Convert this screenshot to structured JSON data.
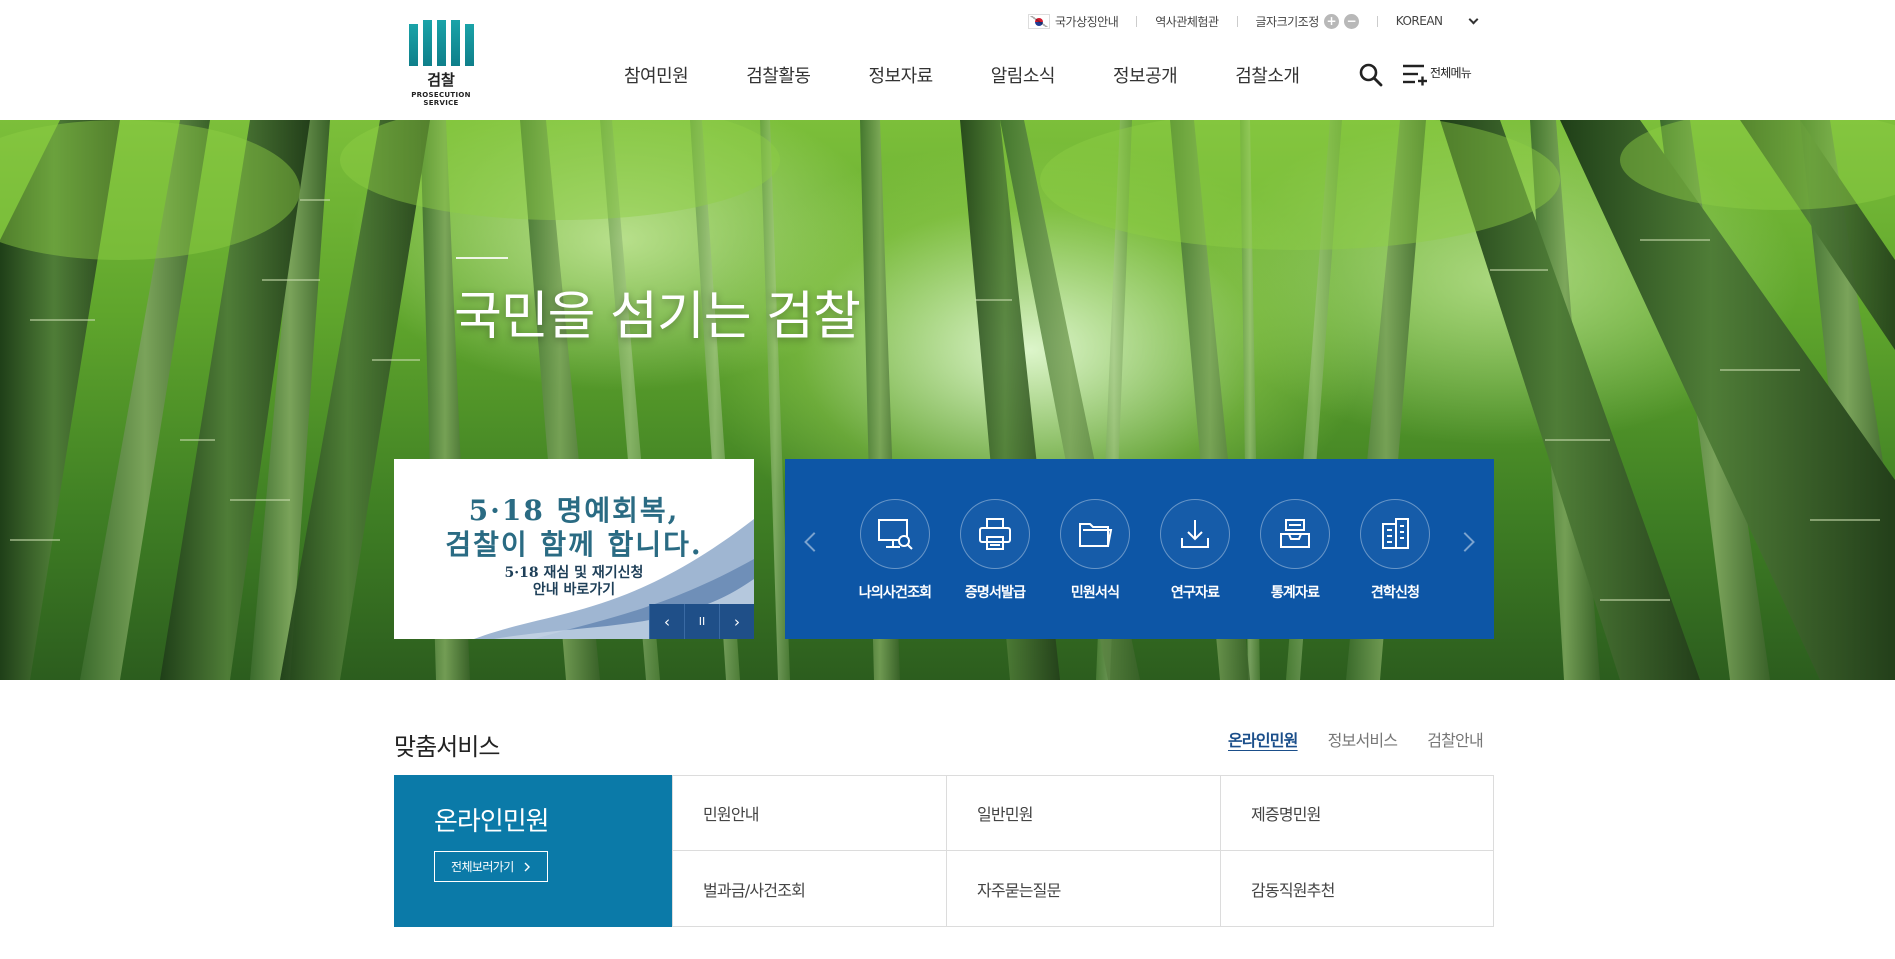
{
  "logo": {
    "ko": "검찰",
    "en": "PROSECUTION SERVICE"
  },
  "util": {
    "symbol": "국가상징안내",
    "history": "역사관체험관",
    "font_size": "글자크기조정",
    "font_plus": "+",
    "font_minus": "−",
    "language": "KOREAN"
  },
  "gnb": [
    "참여민원",
    "검찰활동",
    "정보자료",
    "알림소식",
    "정보공개",
    "검찰소개"
  ],
  "all_menu_label": "전체메뉴",
  "hero": {
    "headline": "국민을 섬기는 검찰"
  },
  "banner": {
    "line1": "5·18 명예회복,",
    "line2": "검찰이 함께 합니다.",
    "line3": "5·18 재심 및 재기신청",
    "line4": "안내 바로가기",
    "prev": "‹",
    "pause": "II",
    "next": "›"
  },
  "quick": [
    {
      "label": "나의사건조회",
      "icon": "monitor-search-icon"
    },
    {
      "label": "증명서발급",
      "icon": "printer-icon"
    },
    {
      "label": "민원서식",
      "icon": "folder-icon"
    },
    {
      "label": "연구자료",
      "icon": "download-icon"
    },
    {
      "label": "통계자료",
      "icon": "inbox-icon"
    },
    {
      "label": "견학신청",
      "icon": "building-icon"
    }
  ],
  "service": {
    "title": "맞춤서비스",
    "tabs": [
      "온라인민원",
      "정보서비스",
      "검찰안내"
    ],
    "active_tab": "온라인민원",
    "panel_title": "온라인민원",
    "more_label": "전체보러가기",
    "cells": [
      "민원안내",
      "일반민원",
      "제증명민원",
      "벌과금/사건조회",
      "자주묻는질문",
      "감동직원추천"
    ]
  },
  "colors": {
    "logo": "#1aa3a8",
    "quick_bg": "#0d56a6",
    "service_bg": "#0b7aa8",
    "tab_active": "#1a4e8a"
  }
}
